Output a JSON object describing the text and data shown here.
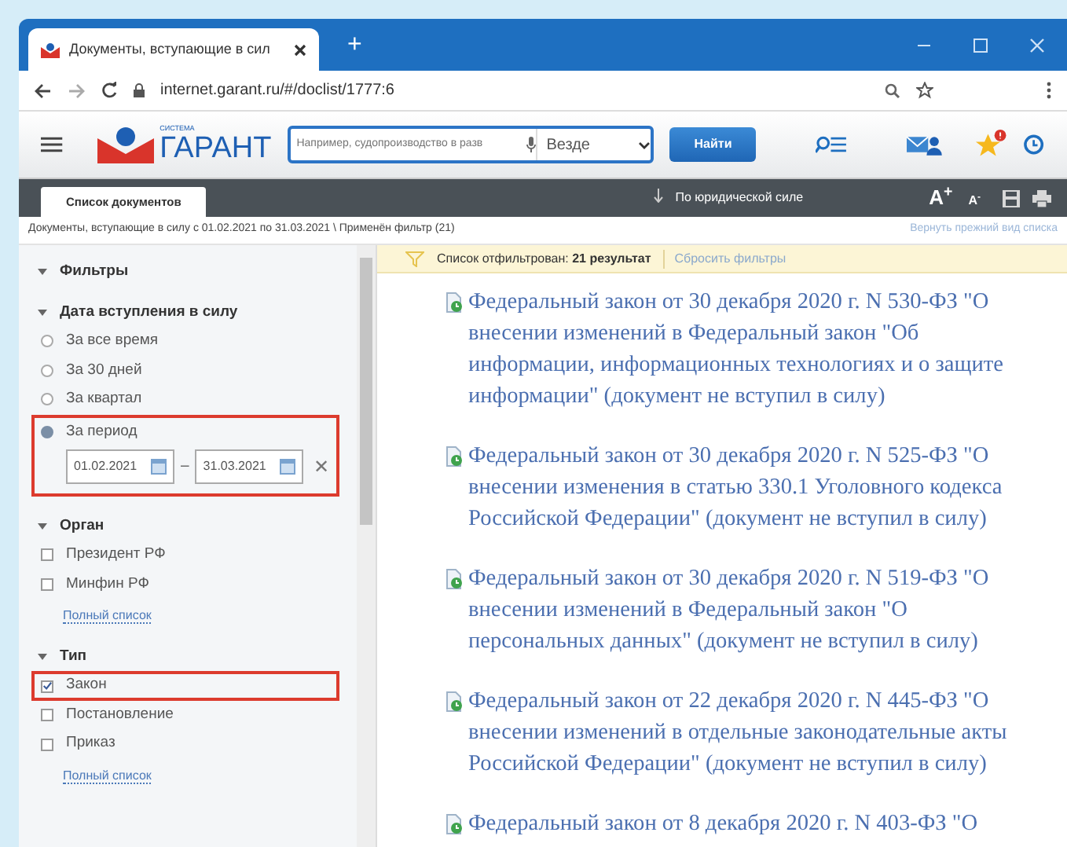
{
  "browser": {
    "tab_title": "Документы, вступающие в сил",
    "new_tab": "+",
    "url": "internet.garant.ru/#/doclist/1777:6"
  },
  "header": {
    "logo_caption": "СИСТЕМА",
    "logo_text": "ГАРАНТ",
    "search_placeholder": "Например, судопроизводство в разв",
    "scope": "Везде",
    "search_button": "Найти"
  },
  "toolbar": {
    "tabs": [
      {
        "label": "Список документов",
        "selected": true
      }
    ],
    "sort": "По юридической силе",
    "font_up": "A$^{+}$",
    "font_down": "A$^{-}$"
  },
  "breadcrumb": "Документы, вступающие в силу с 01.02.2021 по 31.03.2021 \\ Применён фильтр (21)",
  "restore_link": "Вернуть прежний вид списка",
  "filters": {
    "title": "Фильтры",
    "expanded": true,
    "sections": [
      {
        "title": "Дата вступления в силу",
        "expanded": true,
        "options": [
          {
            "kind": "radio",
            "label": "За все время",
            "checked": false,
            "highlighted": false
          },
          {
            "kind": "radio",
            "label": "За 30 дней",
            "checked": false,
            "highlighted": false
          },
          {
            "kind": "radio",
            "label": "За квартал",
            "checked": false,
            "highlighted": false
          },
          {
            "kind": "radio",
            "label": "За период",
            "checked": true,
            "highlighted": true,
            "range": {
              "from": "01.02.2021",
              "to": "31.03.2021",
              "separator": "–",
              "clear": "✕"
            }
          }
        ]
      },
      {
        "title": "Орган",
        "expanded": true,
        "options": [
          {
            "kind": "checkbox",
            "label": "Президент РФ",
            "checked": false,
            "highlighted": false
          },
          {
            "kind": "checkbox",
            "label": "Минфин РФ",
            "checked": false,
            "highlighted": false
          }
        ],
        "more_link": "Полный список"
      },
      {
        "title": "Тип",
        "expanded": true,
        "options": [
          {
            "kind": "checkbox",
            "label": "Закон",
            "checked": true,
            "highlighted": true
          },
          {
            "kind": "checkbox",
            "label": "Постановление",
            "checked": false,
            "highlighted": false
          },
          {
            "kind": "checkbox",
            "label": "Приказ",
            "checked": false,
            "highlighted": false
          }
        ],
        "more_link": "Полный список"
      }
    ]
  },
  "filter_bar": {
    "text": "Список отфильтрован: **21 результат**",
    "reset": "Сбросить фильтры"
  },
  "documents": [
    {
      "title": "Федеральный закон от 30 декабря 2020 г. N 530-ФЗ \"О внесении изменений в Федеральный закон \"Об информации, информационных технологиях и о защите информации\" (документ не вступил в силу)"
    },
    {
      "title": "Федеральный закон от 30 декабря 2020 г. N 525-ФЗ \"О внесении изменения в статью 330.1 Уголовного кодекса Российской Федерации\" (документ не вступил в силу)"
    },
    {
      "title": "Федеральный закон от 30 декабря 2020 г. N 519-ФЗ \"О внесении изменений в Федеральный закон \"О персональных данных\" (документ не вступил в силу)"
    },
    {
      "title": "Федеральный закон от 22 декабря 2020 г. N 445-ФЗ \"О внесении изменений в отдельные законодательные акты Российской Федерации\" (документ не вступил в силу)"
    },
    {
      "title": "Федеральный закон от 8 декабря 2020 г. N 403-ФЗ \"О"
    }
  ]
}
